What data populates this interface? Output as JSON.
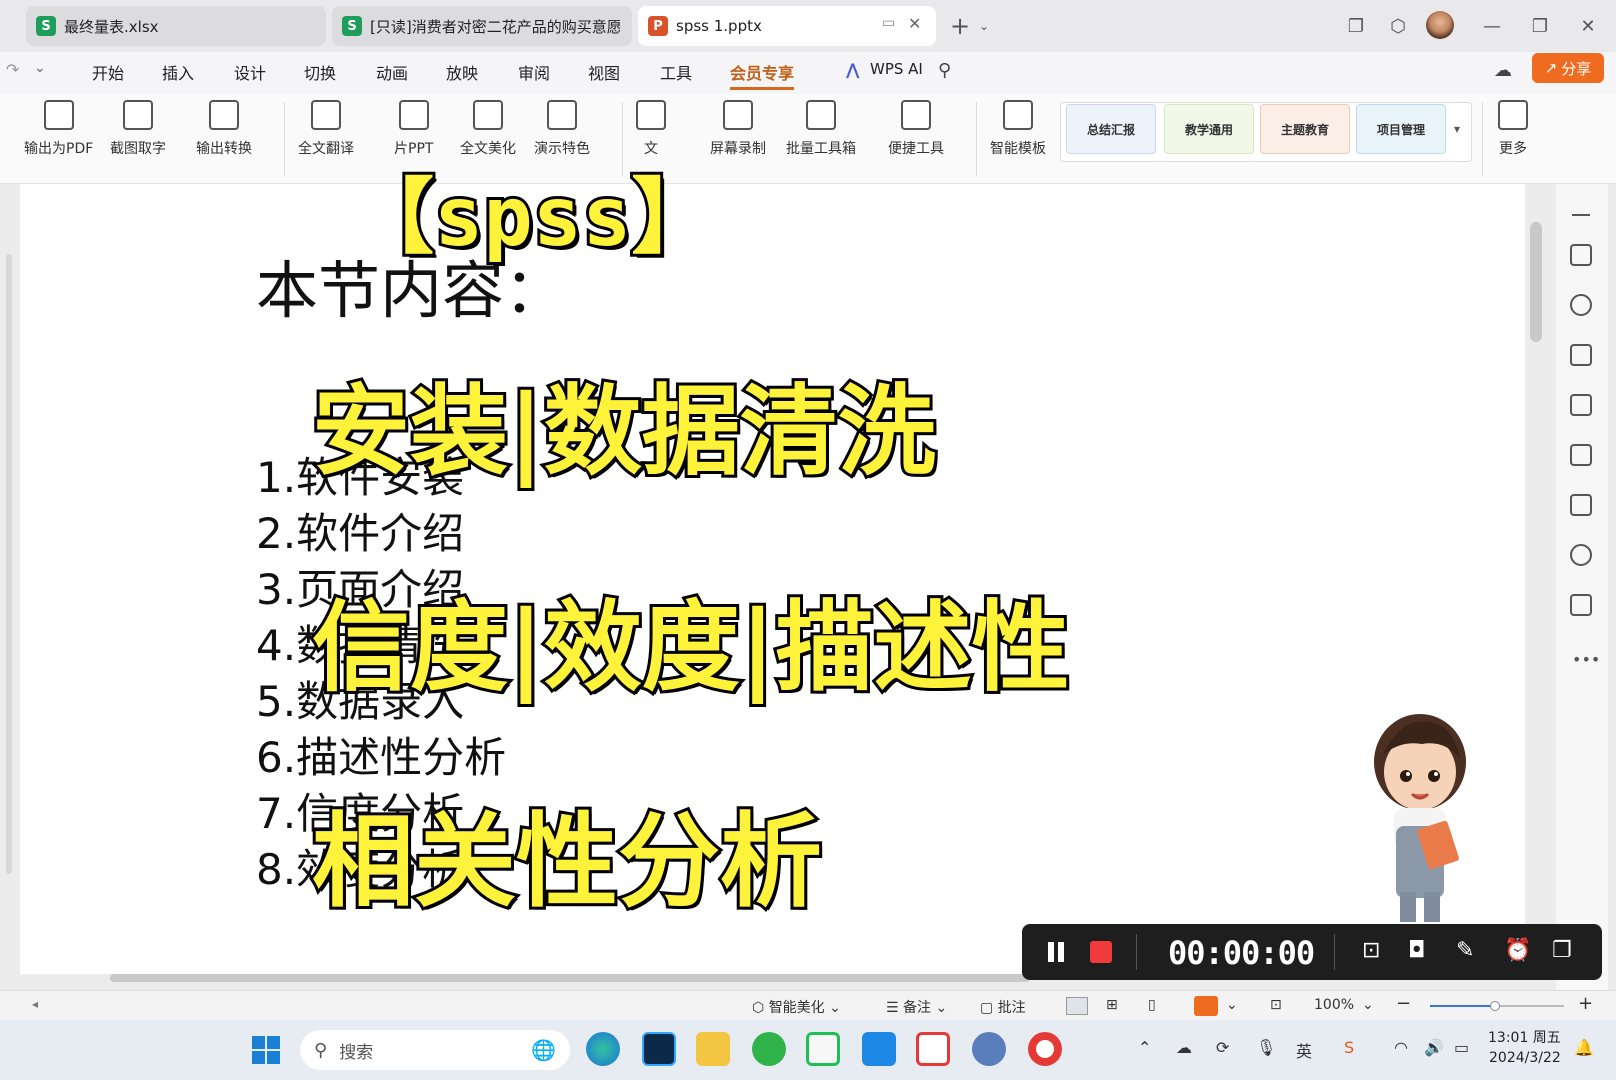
{
  "tabs": [
    {
      "label": "最终量表.xlsx",
      "badge": "S",
      "color": "#1e9e5a"
    },
    {
      "label": "[只读]消费者对密二花产品的购买意愿",
      "badge": "S",
      "color": "#1e9e5a"
    },
    {
      "label": "spss 1.pptx",
      "badge": "P",
      "color": "#d8532a"
    }
  ],
  "menu": [
    "开始",
    "插入",
    "设计",
    "切换",
    "动画",
    "放映",
    "审阅",
    "视图",
    "工具",
    "会员专享"
  ],
  "wps_ai": "WPS AI",
  "share": "分享",
  "ribbon_tools": [
    "输出为PDF",
    "截图取字",
    "输出转换",
    "全文翻译",
    "片PPT",
    "全文美化",
    "演示特色",
    "文",
    "屏幕录制",
    "批量工具箱",
    "便捷工具",
    "智能模板",
    "更多"
  ],
  "templates": [
    "总结汇报",
    "教学通用",
    "主题教育",
    "项目管理"
  ],
  "slide": {
    "heading": "本节内容：",
    "items": [
      "1.软件安装",
      "2.软件介绍",
      "3.页面介绍",
      "4.数据清洗",
      "5.数据录入",
      "6.描述性分析",
      "7.信度分析",
      "8.效度分析"
    ]
  },
  "overlay": {
    "title": "【spss】",
    "line1": "安装|数据清洗",
    "line2": "信度|效度|描述性",
    "line3": "相关性分析"
  },
  "recorder": {
    "time": "00:00:00"
  },
  "statusbar": {
    "beautify": "智能美化",
    "notes": "备注",
    "comment": "批注",
    "zoom": "100%"
  },
  "taskbar": {
    "search_placeholder": "搜索",
    "time": "13:01 周五",
    "date": "2024/3/22",
    "ime": "英"
  },
  "colors": {
    "accent": "#ef6b1f",
    "overlay_text": "#fff23a",
    "recorder_bg": "#1e1e1f"
  }
}
